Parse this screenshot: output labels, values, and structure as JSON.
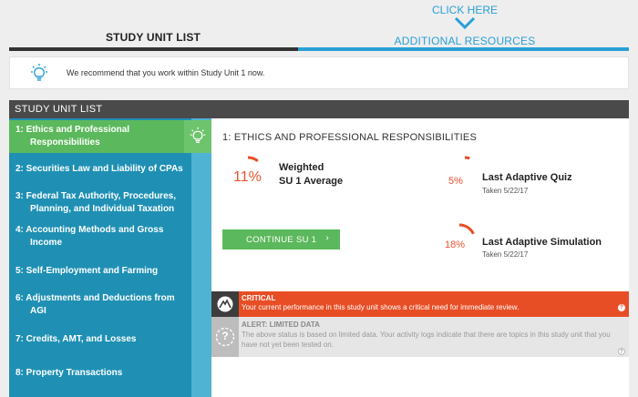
{
  "tabs": {
    "click_here": "CLICK HERE",
    "study_unit_list": "STUDY UNIT LIST",
    "additional_resources": "ADDITIONAL RESOURCES"
  },
  "recommendation": {
    "icon": "lightbulb-icon",
    "text": "We recommend that you work within Study Unit 1 now."
  },
  "panel": {
    "header": "STUDY UNIT LIST"
  },
  "sidebar": {
    "items": [
      {
        "line1": "1: Ethics and Professional",
        "line2": "Responsibilities"
      },
      {
        "line1": "2: Securities Law and Liability of CPAs",
        "line2": ""
      },
      {
        "line1": "3: Federal Tax Authority, Procedures,",
        "line2": "Planning, and Individual Taxation"
      },
      {
        "line1": "4: Accounting Methods and Gross",
        "line2": "Income"
      },
      {
        "line1": "5: Self-Employment and Farming",
        "line2": ""
      },
      {
        "line1": "6: Adjustments and Deductions from",
        "line2": "AGI"
      },
      {
        "line1": "7: Credits, AMT, and Losses",
        "line2": ""
      },
      {
        "line1": "8: Property Transactions",
        "line2": ""
      }
    ]
  },
  "main": {
    "title": "1: ETHICS AND PROFESSIONAL RESPONSIBILITIES",
    "weighted": {
      "percent": "11%",
      "value": 11,
      "label1": "Weighted",
      "label2": "SU 1 Average"
    },
    "quiz": {
      "percent": "5%",
      "value": 5,
      "label": "Last Adaptive Quiz",
      "sub": "Taken 5/22/17"
    },
    "simulation": {
      "percent": "18%",
      "value": 18,
      "label": "Last Adaptive Simulation",
      "sub": "Taken 5/22/17"
    },
    "continue_label": "CONTINUE SU 1",
    "continue_chevron": "›"
  },
  "critical": {
    "title": "CRITICAL",
    "text": "Your current performance in this study unit shows a critical need for immediate review.",
    "help": "?"
  },
  "alert": {
    "title": "ALERT: LIMITED DATA",
    "text": "The above status is based on limited data. Your activity logs indicate that there are topics in this study unit that you have not yet been tested on.",
    "help": "?",
    "icon_glyph": "?"
  },
  "colors": {
    "accent_blue": "#2a9fd6",
    "sidebar_blue": "#1f90b4",
    "active_green": "#5cb85c",
    "critical_red": "#e84e26"
  }
}
